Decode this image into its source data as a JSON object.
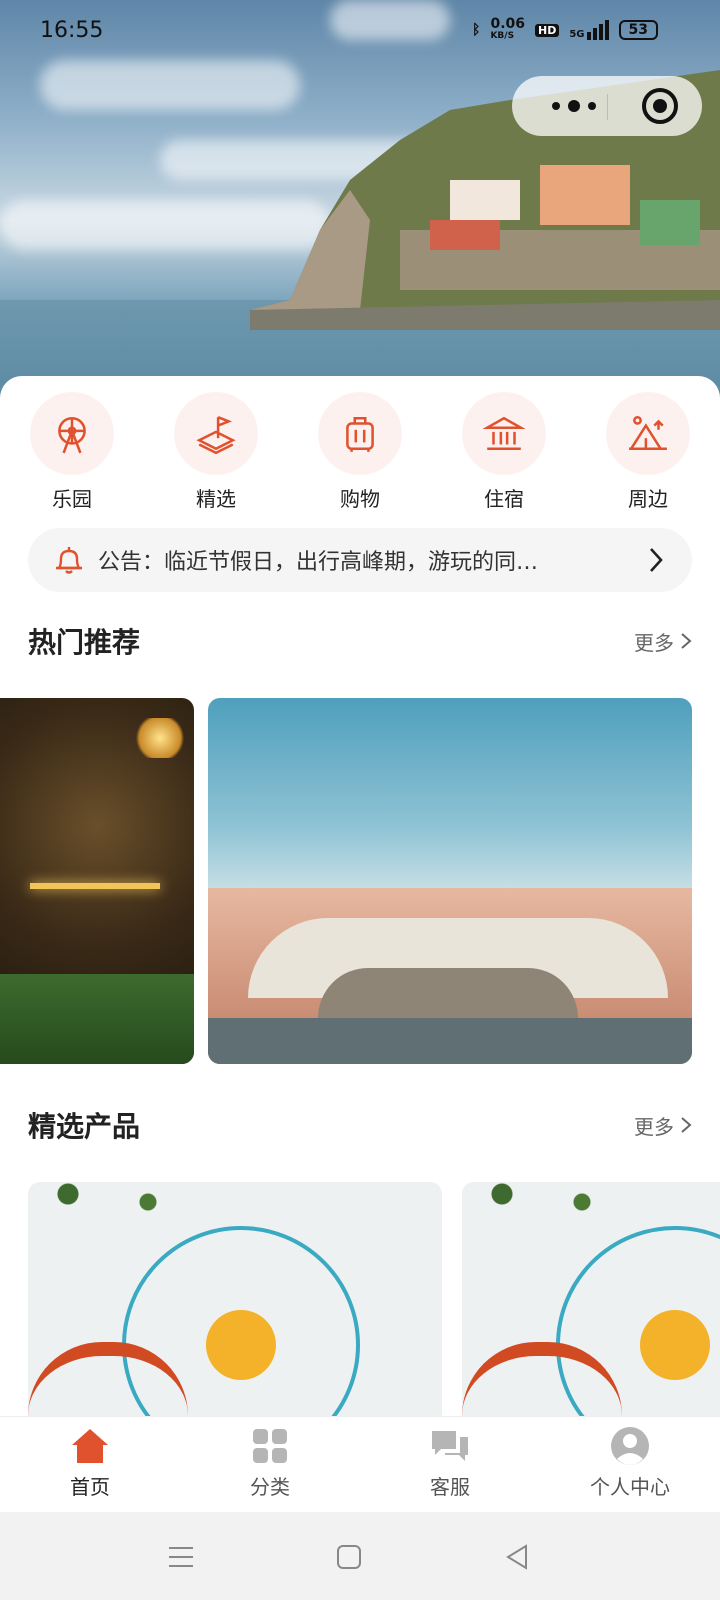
{
  "status_bar": {
    "time": "16:55",
    "network_speed": "0.06",
    "network_unit": "KB/S",
    "hd_badge": "HD",
    "signal": "5G",
    "battery": "53"
  },
  "categories": [
    {
      "label": "乐园",
      "icon": "ferris-wheel-icon"
    },
    {
      "label": "精选",
      "icon": "flag-map-icon"
    },
    {
      "label": "购物",
      "icon": "luggage-icon"
    },
    {
      "label": "住宿",
      "icon": "building-icon"
    },
    {
      "label": "周边",
      "icon": "tent-icon"
    }
  ],
  "notice": {
    "text": "公告：临近节假日，出行高峰期，游玩的同…"
  },
  "hot_section": {
    "title": "热门推荐",
    "more": "更多"
  },
  "featured_section": {
    "title": "精选产品",
    "more": "更多"
  },
  "tabbar": [
    {
      "label": "首页",
      "icon": "home-icon",
      "active": true
    },
    {
      "label": "分类",
      "icon": "grid-icon",
      "active": false
    },
    {
      "label": "客服",
      "icon": "chat-icon",
      "active": false
    },
    {
      "label": "个人中心",
      "icon": "user-icon",
      "active": false
    }
  ],
  "colors": {
    "accent": "#e0522e",
    "category_bg": "#fdf1ef",
    "inactive_icon": "#b5b5b5"
  }
}
